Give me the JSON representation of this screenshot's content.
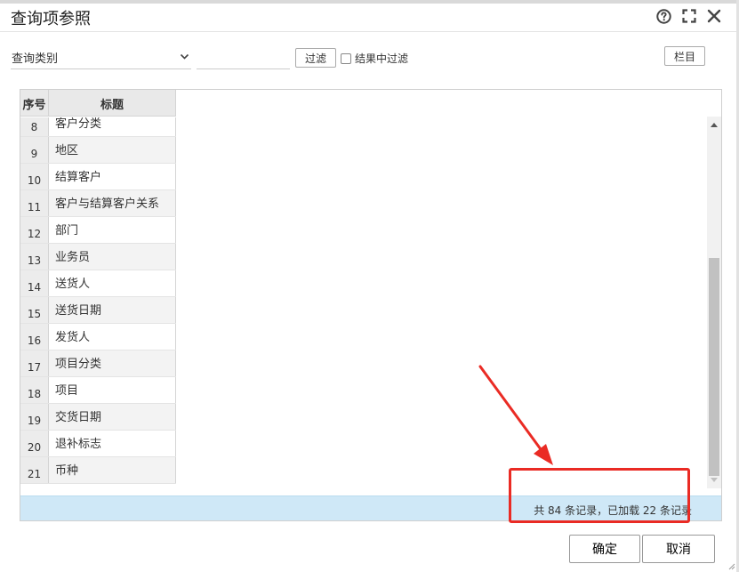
{
  "dialog": {
    "title": "查询项参照",
    "icons": [
      "help-icon",
      "maximize-icon",
      "close-icon"
    ]
  },
  "toolbar": {
    "category_select": {
      "value": "查询类别"
    },
    "filter_input": {
      "value": "",
      "placeholder": ""
    },
    "filter_label": "过滤",
    "filter_in_results_label": "结果中过滤",
    "columns_label": "栏目"
  },
  "grid": {
    "headers": {
      "seq": "序号",
      "title": "标题"
    },
    "rows": [
      {
        "seq": "8",
        "title": "客户分类"
      },
      {
        "seq": "9",
        "title": "地区"
      },
      {
        "seq": "10",
        "title": "结算客户"
      },
      {
        "seq": "11",
        "title": "客户与结算客户关系"
      },
      {
        "seq": "12",
        "title": "部门"
      },
      {
        "seq": "13",
        "title": "业务员"
      },
      {
        "seq": "14",
        "title": "送货人"
      },
      {
        "seq": "15",
        "title": "送货日期"
      },
      {
        "seq": "16",
        "title": "发货人"
      },
      {
        "seq": "17",
        "title": "项目分类"
      },
      {
        "seq": "18",
        "title": "项目"
      },
      {
        "seq": "19",
        "title": "交货日期"
      },
      {
        "seq": "20",
        "title": "退补标志"
      },
      {
        "seq": "21",
        "title": "币种"
      }
    ]
  },
  "status": {
    "text": "共 84 条记录，已加载 22 条记录"
  },
  "footer": {
    "ok_label": "确定",
    "cancel_label": "取消"
  },
  "colors": {
    "status_bg": "#cfe8f7",
    "annotation_red": "#ea2b24"
  }
}
